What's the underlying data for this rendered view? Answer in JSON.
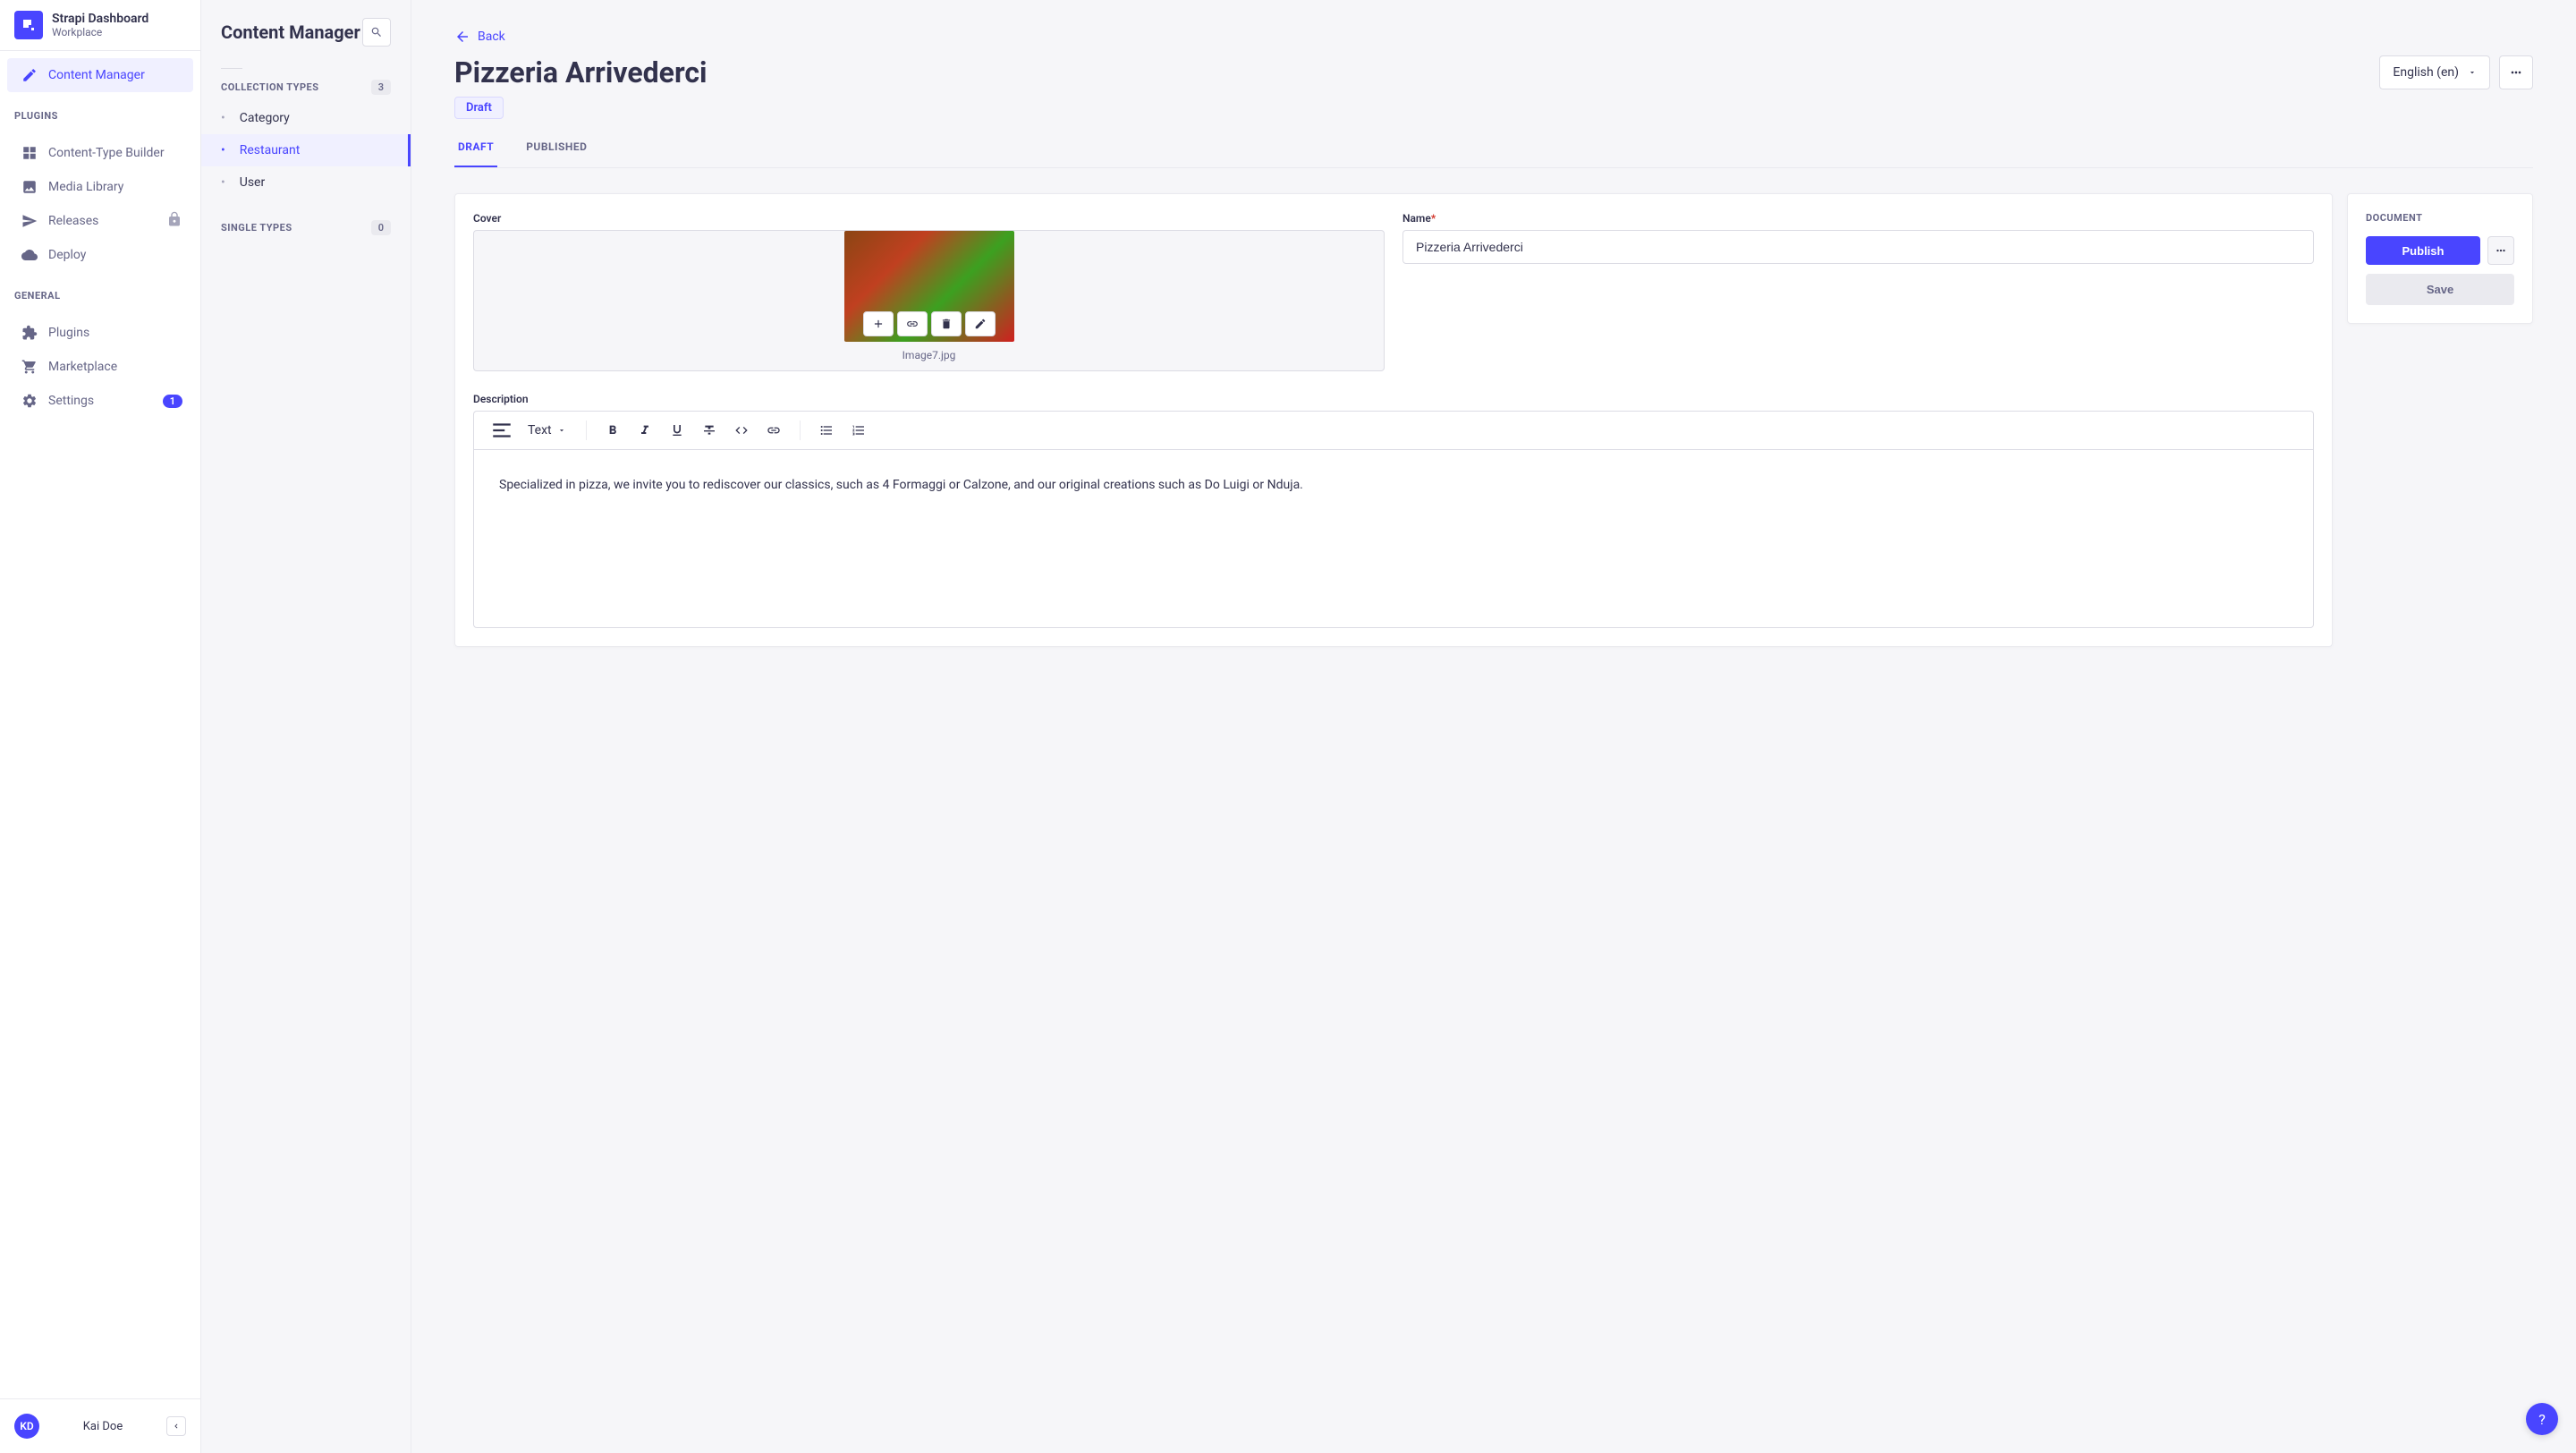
{
  "sidebar": {
    "title": "Strapi Dashboard",
    "subtitle": "Workplace",
    "items": [
      {
        "label": "Content Manager"
      }
    ],
    "plugins_label": "PLUGINS",
    "plugins": [
      {
        "label": "Content-Type Builder"
      },
      {
        "label": "Media Library"
      },
      {
        "label": "Releases"
      },
      {
        "label": "Deploy"
      }
    ],
    "general_label": "GENERAL",
    "general": [
      {
        "label": "Plugins"
      },
      {
        "label": "Marketplace"
      },
      {
        "label": "Settings",
        "badge": "1"
      }
    ]
  },
  "user": {
    "initials": "KD",
    "name": "Kai Doe"
  },
  "midColumn": {
    "title": "Content Manager",
    "collection_label": "COLLECTION TYPES",
    "collection_count": "3",
    "collection_items": [
      {
        "label": "Category"
      },
      {
        "label": "Restaurant"
      },
      {
        "label": "User"
      }
    ],
    "single_label": "SINGLE TYPES",
    "single_count": "0"
  },
  "main": {
    "back": "Back",
    "title": "Pizzeria Arrivederci",
    "language": "English (en)",
    "status": "Draft",
    "tabs": {
      "draft": "DRAFT",
      "published": "PUBLISHED"
    },
    "fields": {
      "cover_label": "Cover",
      "cover_filename": "Image7.jpg",
      "name_label": "Name",
      "name_value": "Pizzeria Arrivederci",
      "description_label": "Description",
      "description_value": "Specialized in pizza, we invite you to rediscover our classics, such as 4 Formaggi or Calzone, and our original creations such as Do Luigi or Nduja.",
      "text_style": "Text"
    }
  },
  "docPanel": {
    "title": "DOCUMENT",
    "publish": "Publish",
    "save": "Save"
  },
  "help": "?"
}
